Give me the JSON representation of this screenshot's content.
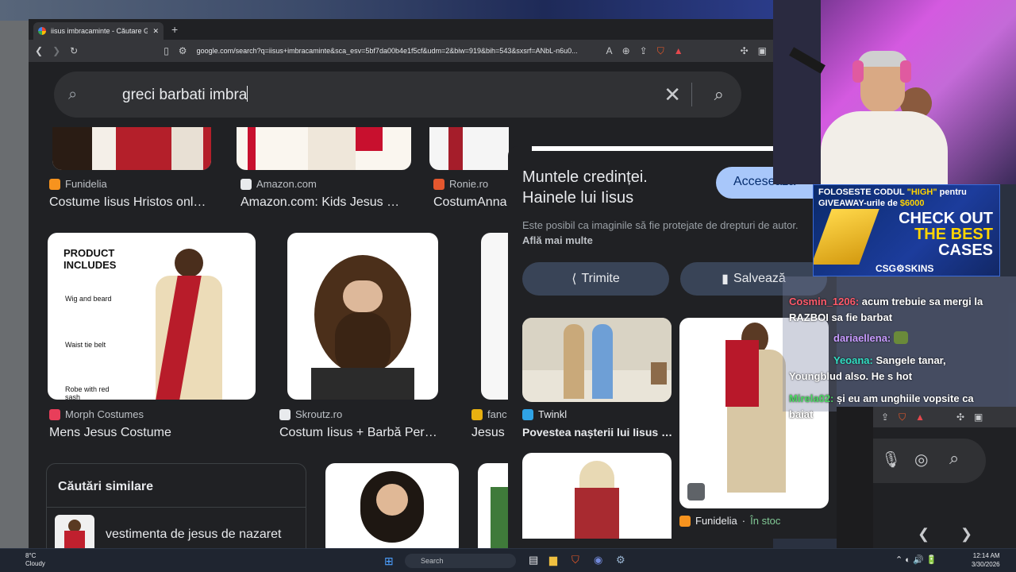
{
  "browser": {
    "tab_title": "iisus imbracaminte - Căutare Go",
    "url": "google.com/search?q=iisus+imbracaminte&sca_esv=5bf7da00b4e1f5cf&udm=2&biw=919&bih=543&sxsrf=ANbL-n6u0..."
  },
  "search": {
    "query": "greci barbati imbra"
  },
  "results": {
    "row1": [
      {
        "source": "Funidelia",
        "title": "Costume Iisus Hristos onl…",
        "fav": "#f7931e"
      },
      {
        "source": "Amazon.com",
        "title": "Amazon.com: Kids Jesus …",
        "fav": "#e8eaed"
      },
      {
        "source": "Ronie.ro",
        "title": "CostumAnna",
        "fav": "#e4572e"
      }
    ],
    "row2": [
      {
        "source": "Morph Costumes",
        "title": "Mens Jesus Costume",
        "fav": "#e83e5a"
      },
      {
        "source": "Skroutz.ro",
        "title": "Costum Iisus + Barbă Per…",
        "fav": "#e8eaed"
      },
      {
        "source": "fanc",
        "title": "Jesus",
        "fav": "#e8b010"
      }
    ],
    "product_labels": {
      "includes": "PRODUCT INCLUDES",
      "wig": "Wig and beard",
      "belt": "Waist tie belt",
      "robe": "Robe with red sash"
    }
  },
  "similar": {
    "heading": "Căutări similare",
    "item": "vestimenta de jesus de nazaret"
  },
  "panel": {
    "title_line1": "Muntele credinței.",
    "title_line2": "Hainele lui Iisus",
    "visit_label": "Accesează",
    "note": "Este posibil ca imaginile să fie protejate de drepturi de autor.",
    "note_link": "Află mai multe",
    "share_label": "Trimite",
    "save_label": "Salvează",
    "rel1_source": "Twinkl",
    "rel1_title": "Povestea nașterii lui Iisus …",
    "rel2_source": "Funidelia",
    "rel2_stock": "În stoc"
  },
  "ad": {
    "line1_a": "FOLOSESTE CODUL ",
    "line1_code": "\"HIGH\"",
    "line1_b": " pentru",
    "line2_a": "GIVEAWAY-urile de ",
    "line2_amount": "$6000",
    "big1": "CHECK OUT",
    "big2": "THE BEST",
    "big3": "CASES",
    "brand": "CSG⚙SKINS"
  },
  "chat": [
    {
      "user": "Cosmin_1206:",
      "text": " acum trebuie sa mergi la RAZBOI sa fie barbat"
    },
    {
      "user": "dariaellena:",
      "text": ""
    },
    {
      "user": "Yeoana:",
      "text": " Sangele tanar, Youngblud also. He s hot"
    },
    {
      "user": "Mirela02:",
      "text": " și eu am unghiile vopsite ca baiat"
    }
  ],
  "taskbar": {
    "temp": "8°C",
    "weather": "Cloudy",
    "search": "Search",
    "time": "12:14 AM",
    "date": "3/30/2026"
  }
}
